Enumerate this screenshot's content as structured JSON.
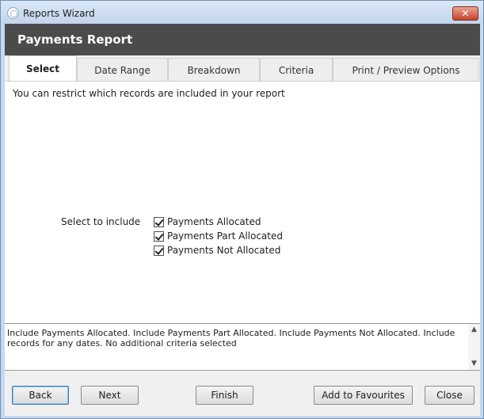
{
  "window": {
    "title": "Reports Wizard",
    "close_glyph": "✕",
    "icon": "app-icon"
  },
  "report": {
    "heading": "Payments Report"
  },
  "tabs": [
    {
      "label": "Select",
      "active": true
    },
    {
      "label": "Date Range",
      "active": false
    },
    {
      "label": "Breakdown",
      "active": false
    },
    {
      "label": "Criteria",
      "active": false
    },
    {
      "label": "Print / Preview Options",
      "active": false
    }
  ],
  "select_panel": {
    "intro": "You can restrict which records are included in your report",
    "include_label": "Select to include",
    "options": [
      {
        "label": "Payments Allocated",
        "checked": true
      },
      {
        "label": "Payments Part Allocated",
        "checked": true
      },
      {
        "label": "Payments Not Allocated",
        "checked": true
      }
    ]
  },
  "summary": {
    "text": "Include Payments Allocated. Include Payments Part Allocated. Include Payments Not Allocated. Include records for any dates. No additional criteria selected",
    "scroll_up": "▲",
    "scroll_down": "▼"
  },
  "buttons": {
    "back": "Back",
    "next": "Next",
    "finish": "Finish",
    "add_to_favourites": "Add to Favourites",
    "close": "Close"
  },
  "colors": {
    "header_bg": "#4b4b4b",
    "titlebar": "#c6d9ef",
    "close_button": "#c7432a"
  }
}
